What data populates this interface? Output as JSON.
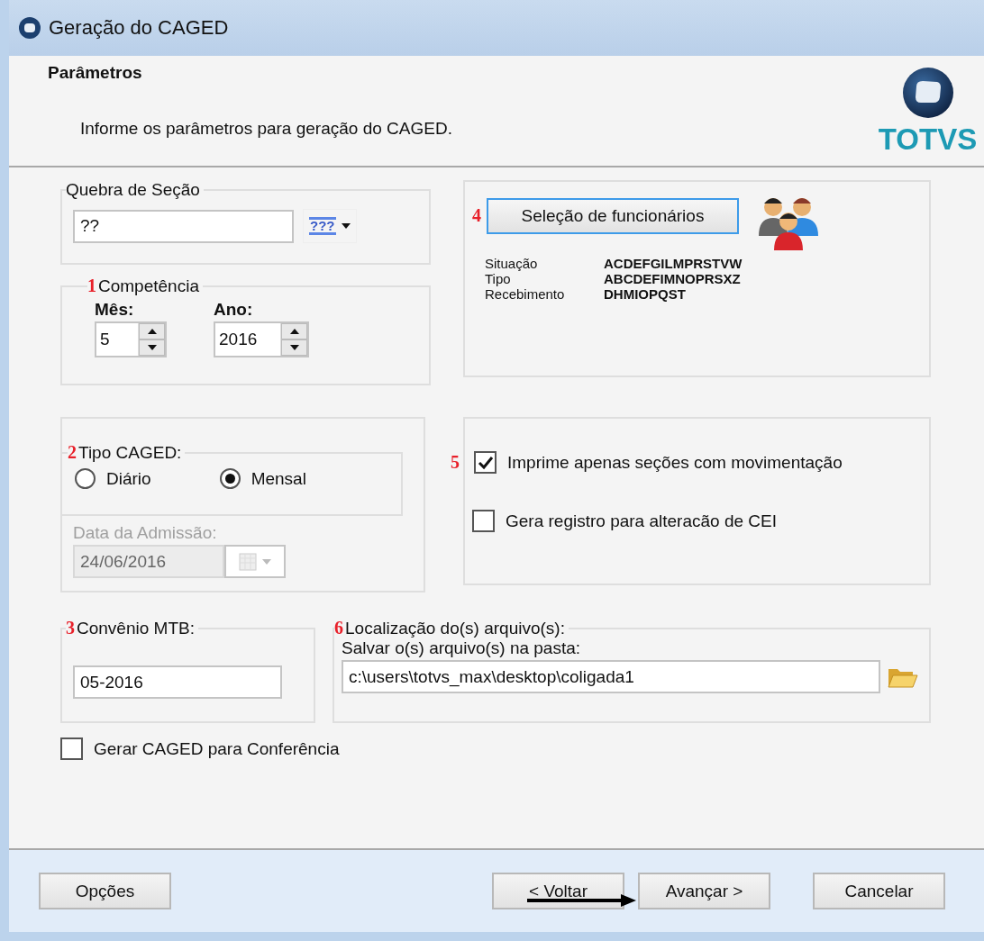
{
  "window": {
    "title": "Geração do CAGED"
  },
  "header": {
    "title": "Parâmetros",
    "subtitle": "Informe os parâmetros para geração do CAGED.",
    "logo_text": "TOTVS"
  },
  "quebra_secao": {
    "label": "Quebra de Seção",
    "value": "??",
    "button_text": "???"
  },
  "competencia": {
    "marker": "1",
    "label": "Competência",
    "mes": {
      "label": "Mês:",
      "value": "5"
    },
    "ano": {
      "label": "Ano:",
      "value": "2016"
    }
  },
  "selecao": {
    "marker": "4",
    "button": "Seleção de funcionários",
    "filters": [
      {
        "label": "Situação",
        "value": "ACDEFGILMPRSTVW"
      },
      {
        "label": "Tipo",
        "value": "ABCDEFIMNOPRSXZ"
      },
      {
        "label": "Recebimento",
        "value": "DHMIOPQST"
      }
    ]
  },
  "tipo_caged": {
    "marker": "2",
    "label": "Tipo CAGED:",
    "options": [
      {
        "label": "Diário",
        "selected": false
      },
      {
        "label": "Mensal",
        "selected": true
      }
    ],
    "data_admissao": {
      "label": "Data da Admissão:",
      "value": "24/06/2016",
      "disabled": true
    }
  },
  "opcoes": {
    "marker": "5",
    "checkboxes": [
      {
        "label": "Imprime apenas seções com movimentação",
        "checked": true
      },
      {
        "label": "Gera registro para alteracão de CEI",
        "checked": false
      }
    ]
  },
  "convenio": {
    "marker": "3",
    "label": "Convênio MTB:",
    "value": "05-2016"
  },
  "localizacao": {
    "marker": "6",
    "label": "Localização do(s) arquivo(s):",
    "sublabel": "Salvar o(s) arquivo(s) na pasta:",
    "value": "c:\\users\\totvs_max\\desktop\\coligada1"
  },
  "conferencia": {
    "label": "Gerar CAGED para Conferência",
    "checked": false
  },
  "buttons": [
    "Opções",
    "< Voltar",
    "Avançar >",
    "Cancelar"
  ]
}
